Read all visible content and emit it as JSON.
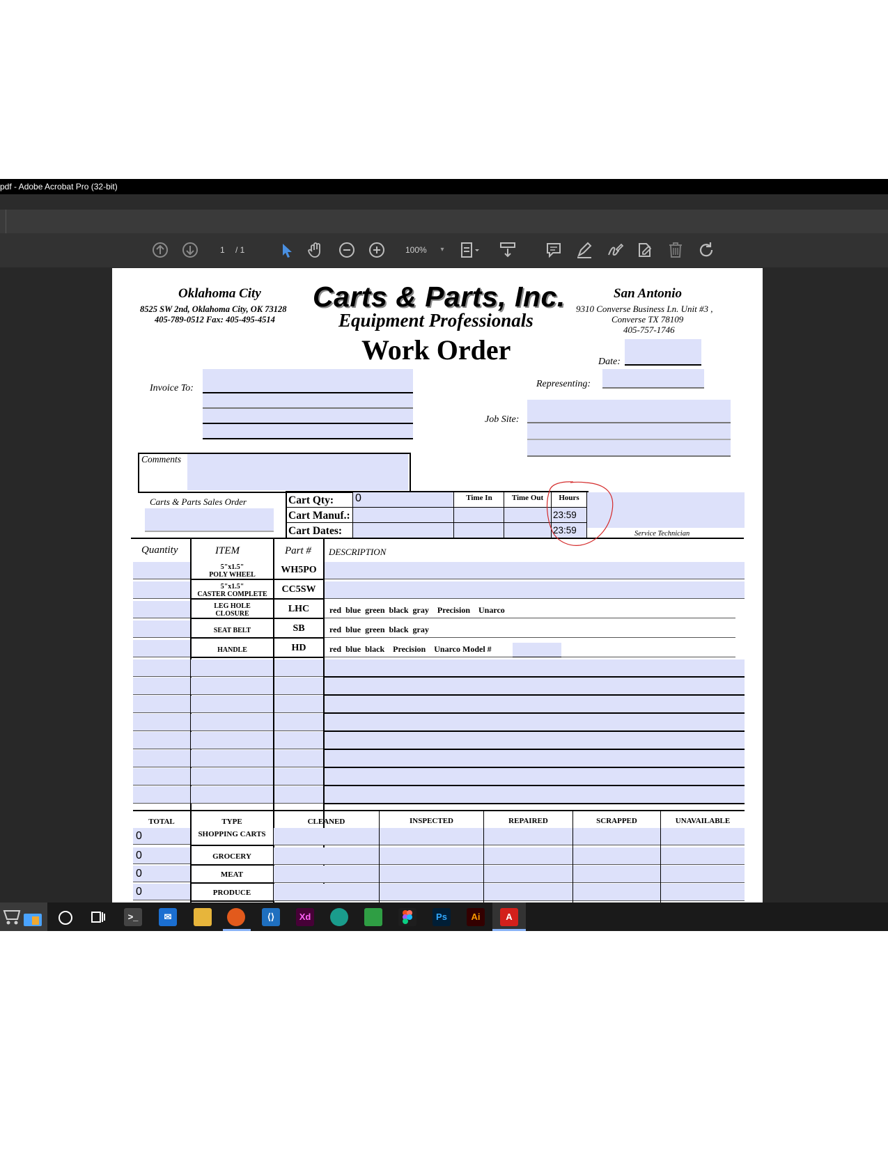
{
  "window": {
    "title": "pdf - Adobe Acrobat Pro (32-bit)"
  },
  "toolbar": {
    "page_current": "1",
    "page_total": "/ 1",
    "zoom": "100%",
    "icons": [
      "arrow-up-icon",
      "arrow-down-icon",
      "select-cursor-icon",
      "hand-icon",
      "zoom-out-icon",
      "zoom-in-icon",
      "zoom-dropdown-icon",
      "fit-page-icon",
      "scroll-mode-icon",
      "comment-icon",
      "highlight-icon",
      "sign-icon",
      "edit-icon",
      "delete-icon",
      "rotate-icon"
    ]
  },
  "form": {
    "left_office": {
      "city": "Oklahoma City",
      "address": "8525 SW 2nd, Oklahoma City, OK 73128",
      "phone": "405-789-0512 Fax: 405-495-4514"
    },
    "company": "Carts & Parts, Inc.",
    "tagline": "Equipment Professionals",
    "doc_title": "Work Order",
    "right_office": {
      "city": "San Antonio",
      "address1": "9310 Converse Business Ln. Unit #3 ,",
      "address2": "Converse TX 78109",
      "phone": "405-757-1746"
    },
    "date_label": "Date:",
    "invoice_label": "Invoice To:",
    "representing_label": "Representing:",
    "jobsite_label": "Job Site:",
    "comments_label": "Comments",
    "sales_order_label": "Carts & Parts Sales Order",
    "cart_qty_label": "Cart Qty:",
    "cart_qty_value": "0",
    "cart_manuf_label": "Cart Manuf.:",
    "cart_dates_label": "Cart Dates:",
    "time_in_label": "Time In",
    "time_out_label": "Time Out",
    "hours_label": "Hours",
    "hours_value_1": "23:59",
    "hours_value_2": "23:59",
    "service_tech_label": "Service Technician",
    "parts_headers": {
      "quantity": "Quantity",
      "item": "ITEM",
      "part": "Part #",
      "description": "DESCRIPTION"
    },
    "parts_rows": [
      {
        "item_line1": "5\"x1.5\"",
        "item_line2": "POLY WHEEL",
        "part": "WH5PO",
        "description": ""
      },
      {
        "item_line1": "5\"x1.5\"",
        "item_line2": "CASTER COMPLETE",
        "part": "CC5SW",
        "description": ""
      },
      {
        "item_line1": "LEG HOLE",
        "item_line2": "CLOSURE",
        "part": "LHC",
        "description": "red  blue  green  black  gray    Precision    Unarco"
      },
      {
        "item_line1": "",
        "item_line2": "SEAT BELT",
        "part": "SB",
        "description": "red  blue  green  black  gray"
      },
      {
        "item_line1": "",
        "item_line2": "HANDLE",
        "part": "HD",
        "description": "red  blue  black    Precision    Unarco Model #"
      }
    ],
    "summary_headers": {
      "total": "TOTAL",
      "type": "TYPE",
      "cleaned": "CLEANED",
      "inspected": "INSPECTED",
      "repaired": "REPAIRED",
      "scrapped": "SCRAPPED",
      "unavailable": "UNAVAILABLE"
    },
    "summary_rows": [
      {
        "total": "0",
        "type": "SHOPPING CARTS"
      },
      {
        "total": "0",
        "type": "GROCERY"
      },
      {
        "total": "0",
        "type": "MEAT"
      },
      {
        "total": "0",
        "type": "PRODUCE"
      }
    ]
  },
  "taskbar": {
    "apps": [
      "store-icon",
      "cortana-icon",
      "task-view-icon",
      "terminal-icon",
      "mail-icon",
      "file-explorer-icon",
      "firefox-icon",
      "vscode-icon",
      "adobe-xd-icon",
      "edge-icon",
      "sheets-icon",
      "figma-icon",
      "photoshop-icon",
      "illustrator-icon",
      "acrobat-icon"
    ],
    "labels": {
      "xd": "Xd",
      "ps": "Ps",
      "ai": "Ai"
    }
  },
  "colors": {
    "field": "#dde1fa",
    "annotation": "#d42b2b",
    "chrome": "#323232"
  }
}
